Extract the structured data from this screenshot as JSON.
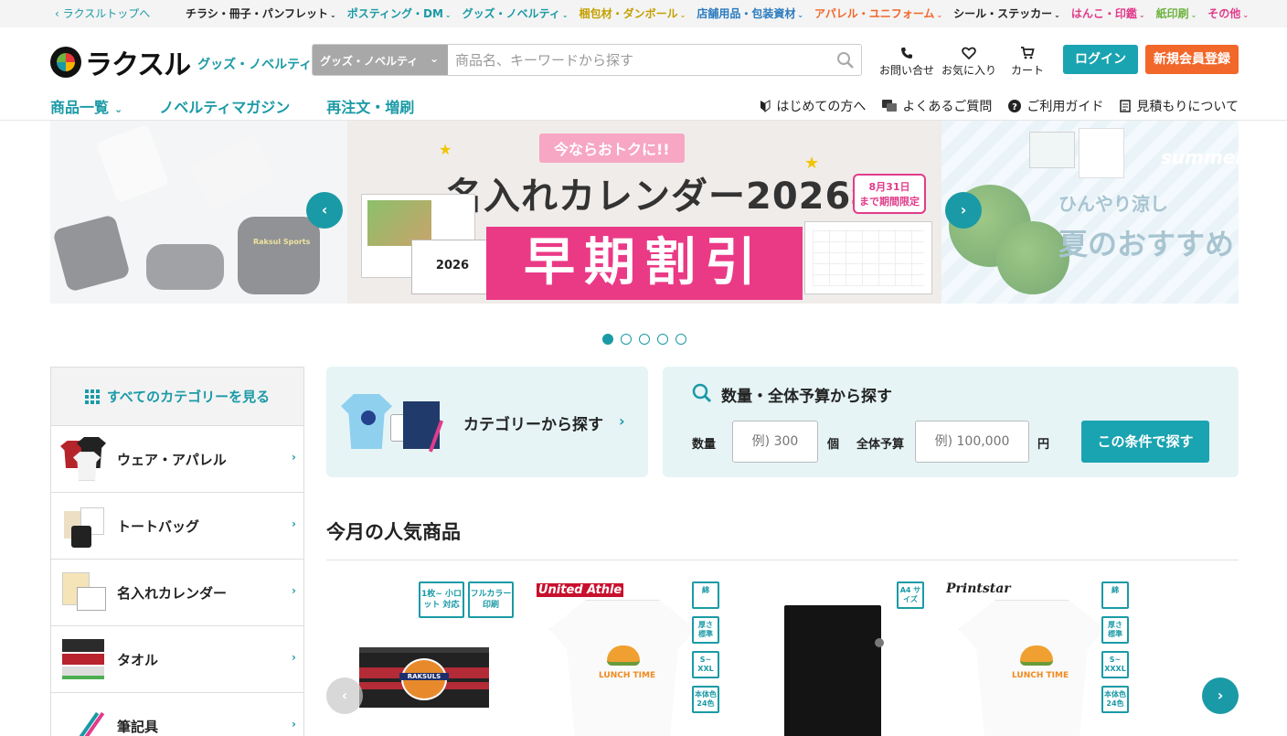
{
  "topbar": {
    "back_label": "ラクスルトップへ",
    "categories": [
      {
        "label": "チラシ・冊子・パンフレット",
        "color": "#222222"
      },
      {
        "label": "ポスティング・DM",
        "color": "#1a9aa6"
      },
      {
        "label": "グッズ・ノベルティ",
        "color": "#1a9aa6"
      },
      {
        "label": "梱包材・ダンボール",
        "color": "#c4a000"
      },
      {
        "label": "店舗用品・包装資材",
        "color": "#2a7bbf"
      },
      {
        "label": "アパレル・ユニフォーム",
        "color": "#f2672a"
      },
      {
        "label": "シール・ステッカー",
        "color": "#222222"
      },
      {
        "label": "はんこ・印鑑",
        "color": "#e03c8b"
      },
      {
        "label": "紙印刷",
        "color": "#6db33f"
      },
      {
        "label": "その他",
        "color": "#e03c8b"
      }
    ]
  },
  "header": {
    "logo_word": "ラクスル",
    "logo_sub": "グッズ・ノベルティ",
    "search_scope": "グッズ・ノベルティ",
    "search_placeholder": "商品名、キーワードから探す",
    "contact_label": "お問い合せ",
    "favorite_label": "お気に入り",
    "cart_label": "カート",
    "login_label": "ログイン",
    "signup_label": "新規会員登録"
  },
  "nav": {
    "items": [
      "商品一覧",
      "ノベルティマガジン",
      "再注文・増刷"
    ],
    "sub_items": [
      "はじめての方へ",
      "よくあるご質問",
      "ご利用ガイド",
      "見積もりについて"
    ]
  },
  "hero": {
    "left_brand_text": "Raksul Sports",
    "center_ribbon": "今ならおトクに!!",
    "center_title": "名入れカレンダー2026年",
    "center_badge_line1": "8月31日",
    "center_badge_line2": "まで期間限定",
    "center_band": "早期割引",
    "center_cal_label": "2026",
    "right_summer": "summer",
    "right_text1": "ひんやり涼し",
    "right_text2": "夏のおすすめ",
    "slide_count": 5,
    "active_slide": 1
  },
  "sidebar": {
    "head_label": "すべてのカテゴリーを見る",
    "items": [
      "ウェア・アパレル",
      "トートバッグ",
      "名入れカレンダー",
      "タオル",
      "筆記具"
    ]
  },
  "category_search": {
    "label": "カテゴリーから探す"
  },
  "qty_search": {
    "title": "数量・全体予算から探す",
    "qty_label": "数量",
    "qty_placeholder": "例) 300",
    "qty_unit": "個",
    "budget_label": "全体予算",
    "budget_placeholder": "例) 100,000",
    "budget_unit": "円",
    "submit_label": "この条件で探す"
  },
  "popular": {
    "title": "今月の人気商品",
    "products": [
      {
        "tags": [
          "1枚~ 小ロット 対応",
          "フルカラー 印刷"
        ],
        "brand": "",
        "print": "RAKSULS"
      },
      {
        "tags": [
          "綿",
          "厚さ 標準",
          "S~ XXL",
          "本体色 24色"
        ],
        "brand": "United Athle",
        "print": "LUNCH TIME"
      },
      {
        "tags": [
          "A4 サイズ"
        ],
        "brand": "",
        "print": ""
      },
      {
        "tags": [
          "綿",
          "厚さ 標準",
          "S~ XXXL",
          "本体色 24色"
        ],
        "brand": "Printstar",
        "print": "LUNCH TIME"
      }
    ]
  }
}
